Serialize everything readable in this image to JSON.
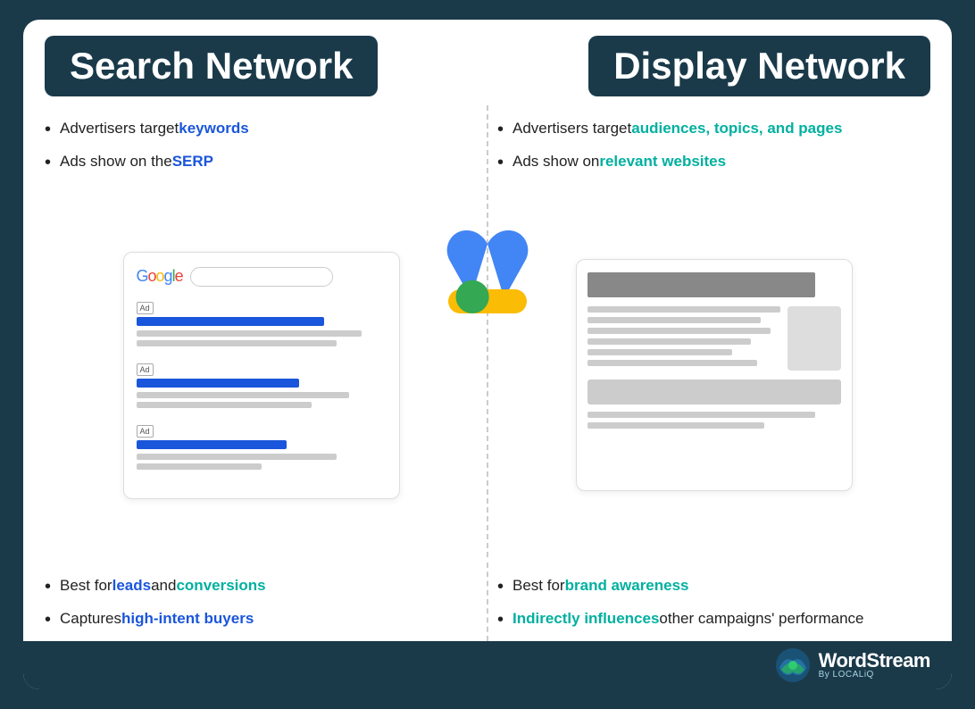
{
  "card": {
    "search_title": "Search Network",
    "display_title": "Display Network"
  },
  "search": {
    "bullets": [
      {
        "prefix": "Advertisers target ",
        "highlight": "keywords",
        "suffix": ""
      },
      {
        "prefix": "Ads show on the ",
        "highlight": "SERP",
        "suffix": ""
      }
    ],
    "bottom_bullets": [
      {
        "prefix": "Best for ",
        "highlight": "leads",
        "mid": " and ",
        "highlight2": "conversions",
        "suffix": ""
      },
      {
        "prefix": "Captures ",
        "highlight": "high-intent buyers",
        "suffix": ""
      }
    ]
  },
  "display": {
    "bullets": [
      {
        "prefix": "Advertisers target ",
        "highlight": "audiences, topics, and pages",
        "suffix": ""
      },
      {
        "prefix": "Ads show on ",
        "highlight": "relevant websites",
        "suffix": ""
      }
    ],
    "bottom_bullets": [
      {
        "prefix": "Best for ",
        "highlight": "brand awareness",
        "suffix": ""
      },
      {
        "prefix": "",
        "highlight": "Indirectly influences",
        "mid": " other campaigns' performance",
        "suffix": ""
      }
    ]
  },
  "footer": {
    "brand": "WordStream",
    "sub": "By LOCALiQ"
  }
}
